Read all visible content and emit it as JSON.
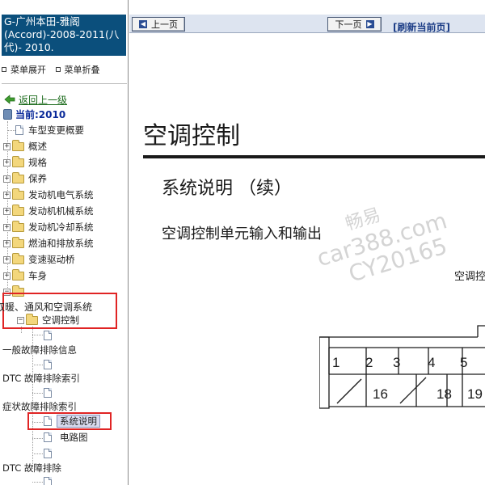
{
  "sidebar": {
    "title": "G-广州本田-雅阁(Accord)-2008-2011(八代)- 2010.",
    "controls": {
      "expand": "菜单展开",
      "collapse": "菜单折叠"
    },
    "back_link": "返回上一级",
    "current": "当前:2010",
    "tree": {
      "overview": "车型变更概要",
      "general": "概述",
      "specs": "规格",
      "maintenance": "保养",
      "engine_electrical": "发动机电气系统",
      "engine_mechanical": "发动机机械系统",
      "engine_cooling": "发动机冷却系统",
      "fuel_exhaust": "燃油和排放系统",
      "transaxle": "变速驱动桥",
      "body": "车身",
      "hvac": "取暖、通风和空调系统",
      "ac_control": "空调控制",
      "general_troubleshooting": "一般故障排除信息",
      "dtc_index": "DTC 故障排除索引",
      "symptom_index": "症状故障排除索引",
      "system_description": "系统说明",
      "circuit_diagram": "电路图",
      "dtc_troubleshooting": "DTC 故障排除"
    }
  },
  "toolbar": {
    "prev": "上一页",
    "next": "下一页",
    "refresh": "[刷新当前页]"
  },
  "document": {
    "title": "空调控制",
    "subtitle": "系统说明 （续）",
    "heading": "空调控制单元输入和输出",
    "cut_label": "空调控",
    "watermark": {
      "line1": "畅易",
      "line2": "car388.com",
      "line3": "CY20165"
    },
    "connector_pins": {
      "row1": [
        "1",
        "2",
        "3",
        "4",
        "5"
      ],
      "row2": [
        "16",
        "18",
        "19"
      ]
    }
  },
  "colors": {
    "title_bg": "#0b4f7c",
    "highlight_box": "#e02424",
    "toolbar_bg": "#dde4f0"
  }
}
